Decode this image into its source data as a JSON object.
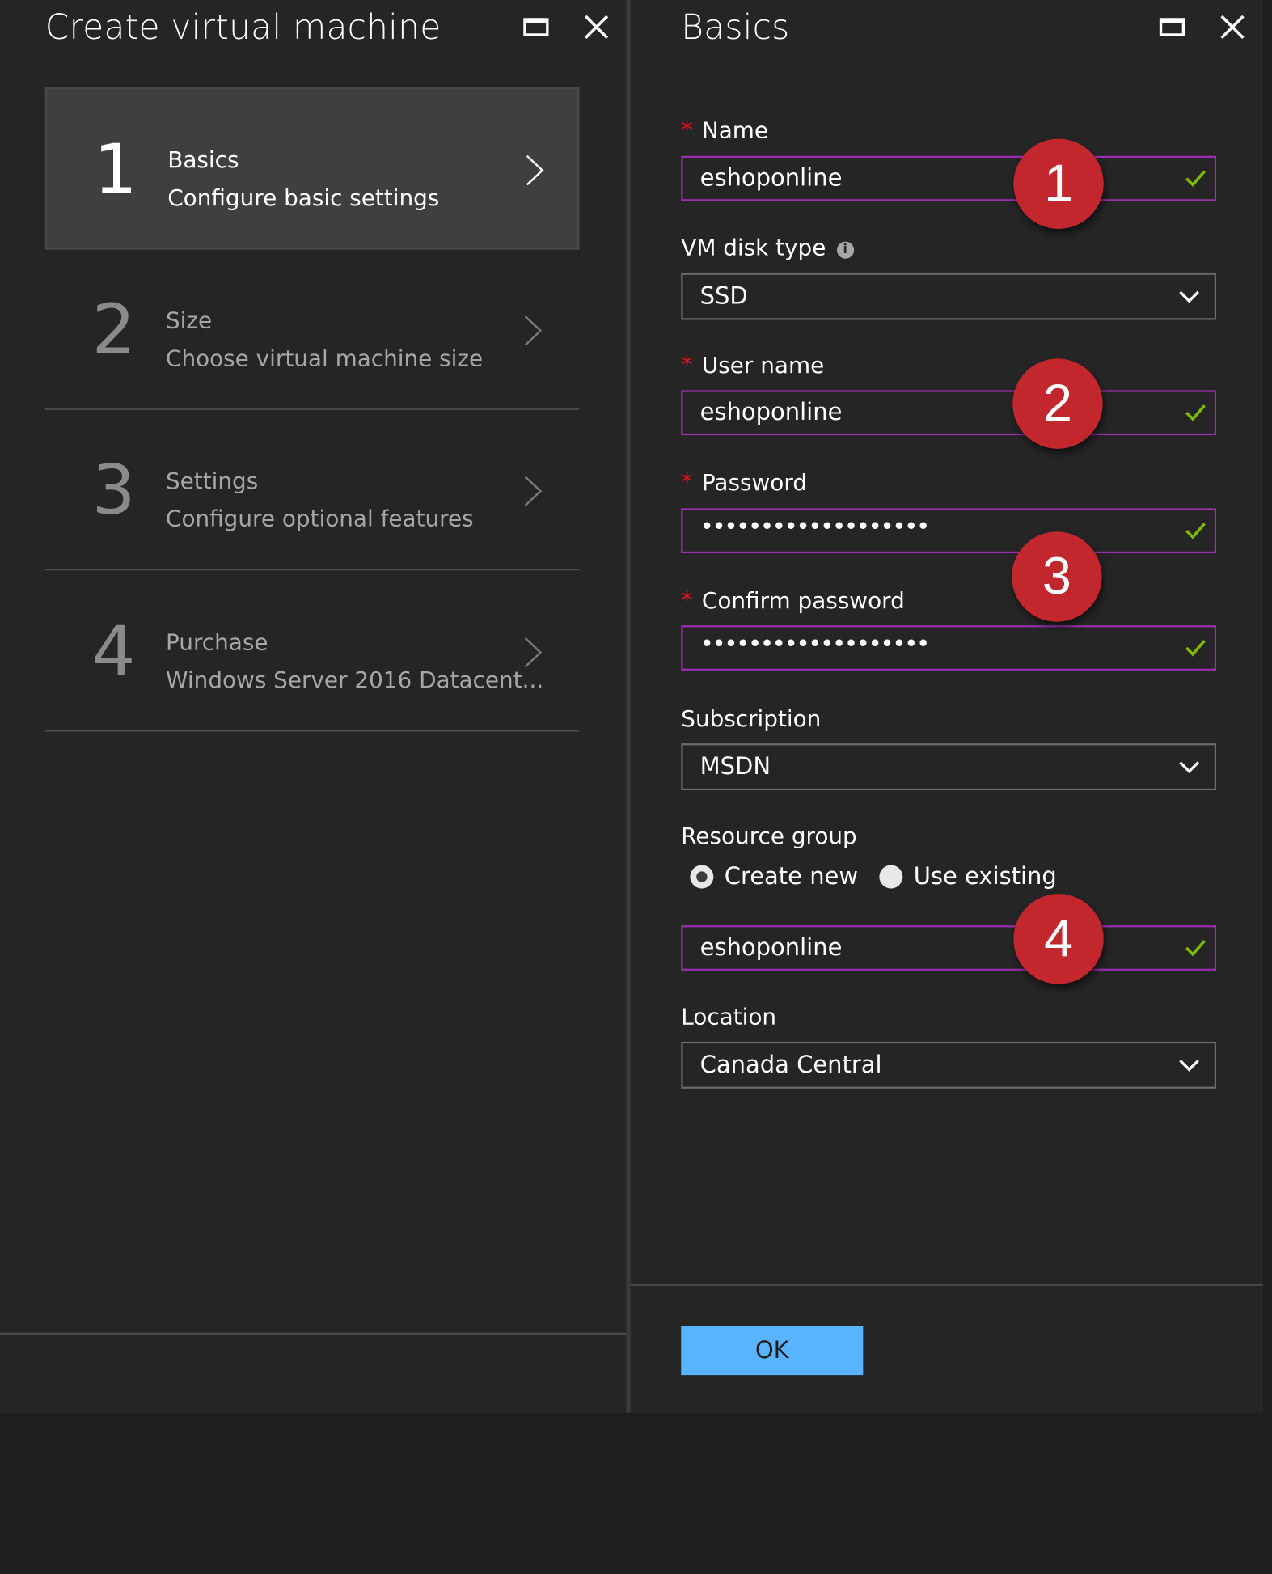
{
  "left_blade": {
    "title": "Create virtual machine",
    "steps": [
      {
        "number": "1",
        "title": "Basics",
        "subtitle": "Configure basic settings",
        "active": true
      },
      {
        "number": "2",
        "title": "Size",
        "subtitle": "Choose virtual machine size",
        "active": false
      },
      {
        "number": "3",
        "title": "Settings",
        "subtitle": "Configure optional features",
        "active": false
      },
      {
        "number": "4",
        "title": "Purchase",
        "subtitle": "Windows Server 2016 Datacent...",
        "active": false
      }
    ]
  },
  "right_blade": {
    "title": "Basics",
    "required_marker": "*",
    "name": {
      "label": "Name",
      "value": "eshoponline",
      "valid": true
    },
    "vm_disk_type": {
      "label": "VM disk type",
      "info_icon": "i",
      "value": "SSD"
    },
    "user_name": {
      "label": "User name",
      "value": "eshoponline",
      "valid": true
    },
    "password": {
      "label": "Password",
      "masked_value": "•••••••••••••••••••",
      "valid": true
    },
    "confirm_password": {
      "label": "Confirm password",
      "masked_value": "•••••••••••••••••••",
      "valid": true
    },
    "subscription": {
      "label": "Subscription",
      "value": "MSDN"
    },
    "resource_group": {
      "label": "Resource group",
      "options": [
        "Create new",
        "Use existing"
      ],
      "selected": "Create new",
      "value": "eshoponline",
      "valid": true
    },
    "location": {
      "label": "Location",
      "value": "Canada Central"
    },
    "ok_label": "OK"
  },
  "annotations": [
    "1",
    "2",
    "3",
    "4"
  ],
  "icons": {
    "maximize": "maximize-icon",
    "close": "close-icon",
    "chevron_right": "chevron-right-icon",
    "chevron_down": "chevron-down-icon",
    "check": "checkmark-icon",
    "info": "info-icon"
  },
  "colors": {
    "background": "#252526",
    "field_border": "#9b2fae",
    "valid_check": "#7fba00",
    "required": "#e81123",
    "ok_button": "#59b4ff",
    "badge": "#c1272d"
  }
}
